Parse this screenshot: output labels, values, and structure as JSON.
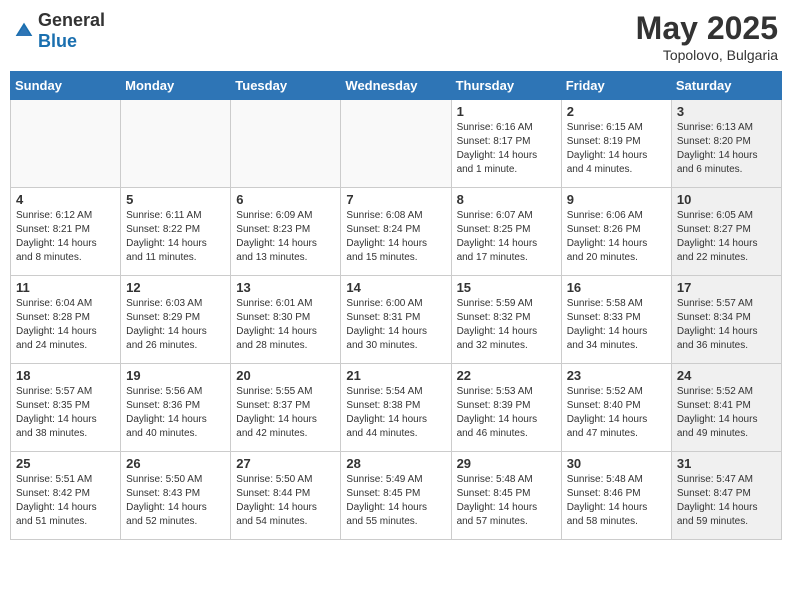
{
  "header": {
    "logo_general": "General",
    "logo_blue": "Blue",
    "month": "May 2025",
    "location": "Topolovo, Bulgaria"
  },
  "days_of_week": [
    "Sunday",
    "Monday",
    "Tuesday",
    "Wednesday",
    "Thursday",
    "Friday",
    "Saturday"
  ],
  "weeks": [
    [
      {
        "day": "",
        "text": "",
        "shaded": false,
        "empty": true
      },
      {
        "day": "",
        "text": "",
        "shaded": false,
        "empty": true
      },
      {
        "day": "",
        "text": "",
        "shaded": false,
        "empty": true
      },
      {
        "day": "",
        "text": "",
        "shaded": false,
        "empty": true
      },
      {
        "day": "1",
        "text": "Sunrise: 6:16 AM\nSunset: 8:17 PM\nDaylight: 14 hours and 1 minute.",
        "shaded": false,
        "empty": false
      },
      {
        "day": "2",
        "text": "Sunrise: 6:15 AM\nSunset: 8:19 PM\nDaylight: 14 hours and 4 minutes.",
        "shaded": false,
        "empty": false
      },
      {
        "day": "3",
        "text": "Sunrise: 6:13 AM\nSunset: 8:20 PM\nDaylight: 14 hours and 6 minutes.",
        "shaded": true,
        "empty": false
      }
    ],
    [
      {
        "day": "4",
        "text": "Sunrise: 6:12 AM\nSunset: 8:21 PM\nDaylight: 14 hours and 8 minutes.",
        "shaded": false,
        "empty": false
      },
      {
        "day": "5",
        "text": "Sunrise: 6:11 AM\nSunset: 8:22 PM\nDaylight: 14 hours and 11 minutes.",
        "shaded": false,
        "empty": false
      },
      {
        "day": "6",
        "text": "Sunrise: 6:09 AM\nSunset: 8:23 PM\nDaylight: 14 hours and 13 minutes.",
        "shaded": false,
        "empty": false
      },
      {
        "day": "7",
        "text": "Sunrise: 6:08 AM\nSunset: 8:24 PM\nDaylight: 14 hours and 15 minutes.",
        "shaded": false,
        "empty": false
      },
      {
        "day": "8",
        "text": "Sunrise: 6:07 AM\nSunset: 8:25 PM\nDaylight: 14 hours and 17 minutes.",
        "shaded": false,
        "empty": false
      },
      {
        "day": "9",
        "text": "Sunrise: 6:06 AM\nSunset: 8:26 PM\nDaylight: 14 hours and 20 minutes.",
        "shaded": false,
        "empty": false
      },
      {
        "day": "10",
        "text": "Sunrise: 6:05 AM\nSunset: 8:27 PM\nDaylight: 14 hours and 22 minutes.",
        "shaded": true,
        "empty": false
      }
    ],
    [
      {
        "day": "11",
        "text": "Sunrise: 6:04 AM\nSunset: 8:28 PM\nDaylight: 14 hours and 24 minutes.",
        "shaded": false,
        "empty": false
      },
      {
        "day": "12",
        "text": "Sunrise: 6:03 AM\nSunset: 8:29 PM\nDaylight: 14 hours and 26 minutes.",
        "shaded": false,
        "empty": false
      },
      {
        "day": "13",
        "text": "Sunrise: 6:01 AM\nSunset: 8:30 PM\nDaylight: 14 hours and 28 minutes.",
        "shaded": false,
        "empty": false
      },
      {
        "day": "14",
        "text": "Sunrise: 6:00 AM\nSunset: 8:31 PM\nDaylight: 14 hours and 30 minutes.",
        "shaded": false,
        "empty": false
      },
      {
        "day": "15",
        "text": "Sunrise: 5:59 AM\nSunset: 8:32 PM\nDaylight: 14 hours and 32 minutes.",
        "shaded": false,
        "empty": false
      },
      {
        "day": "16",
        "text": "Sunrise: 5:58 AM\nSunset: 8:33 PM\nDaylight: 14 hours and 34 minutes.",
        "shaded": false,
        "empty": false
      },
      {
        "day": "17",
        "text": "Sunrise: 5:57 AM\nSunset: 8:34 PM\nDaylight: 14 hours and 36 minutes.",
        "shaded": true,
        "empty": false
      }
    ],
    [
      {
        "day": "18",
        "text": "Sunrise: 5:57 AM\nSunset: 8:35 PM\nDaylight: 14 hours and 38 minutes.",
        "shaded": false,
        "empty": false
      },
      {
        "day": "19",
        "text": "Sunrise: 5:56 AM\nSunset: 8:36 PM\nDaylight: 14 hours and 40 minutes.",
        "shaded": false,
        "empty": false
      },
      {
        "day": "20",
        "text": "Sunrise: 5:55 AM\nSunset: 8:37 PM\nDaylight: 14 hours and 42 minutes.",
        "shaded": false,
        "empty": false
      },
      {
        "day": "21",
        "text": "Sunrise: 5:54 AM\nSunset: 8:38 PM\nDaylight: 14 hours and 44 minutes.",
        "shaded": false,
        "empty": false
      },
      {
        "day": "22",
        "text": "Sunrise: 5:53 AM\nSunset: 8:39 PM\nDaylight: 14 hours and 46 minutes.",
        "shaded": false,
        "empty": false
      },
      {
        "day": "23",
        "text": "Sunrise: 5:52 AM\nSunset: 8:40 PM\nDaylight: 14 hours and 47 minutes.",
        "shaded": false,
        "empty": false
      },
      {
        "day": "24",
        "text": "Sunrise: 5:52 AM\nSunset: 8:41 PM\nDaylight: 14 hours and 49 minutes.",
        "shaded": true,
        "empty": false
      }
    ],
    [
      {
        "day": "25",
        "text": "Sunrise: 5:51 AM\nSunset: 8:42 PM\nDaylight: 14 hours and 51 minutes.",
        "shaded": false,
        "empty": false
      },
      {
        "day": "26",
        "text": "Sunrise: 5:50 AM\nSunset: 8:43 PM\nDaylight: 14 hours and 52 minutes.",
        "shaded": false,
        "empty": false
      },
      {
        "day": "27",
        "text": "Sunrise: 5:50 AM\nSunset: 8:44 PM\nDaylight: 14 hours and 54 minutes.",
        "shaded": false,
        "empty": false
      },
      {
        "day": "28",
        "text": "Sunrise: 5:49 AM\nSunset: 8:45 PM\nDaylight: 14 hours and 55 minutes.",
        "shaded": false,
        "empty": false
      },
      {
        "day": "29",
        "text": "Sunrise: 5:48 AM\nSunset: 8:45 PM\nDaylight: 14 hours and 57 minutes.",
        "shaded": false,
        "empty": false
      },
      {
        "day": "30",
        "text": "Sunrise: 5:48 AM\nSunset: 8:46 PM\nDaylight: 14 hours and 58 minutes.",
        "shaded": false,
        "empty": false
      },
      {
        "day": "31",
        "text": "Sunrise: 5:47 AM\nSunset: 8:47 PM\nDaylight: 14 hours and 59 minutes.",
        "shaded": true,
        "empty": false
      }
    ]
  ]
}
